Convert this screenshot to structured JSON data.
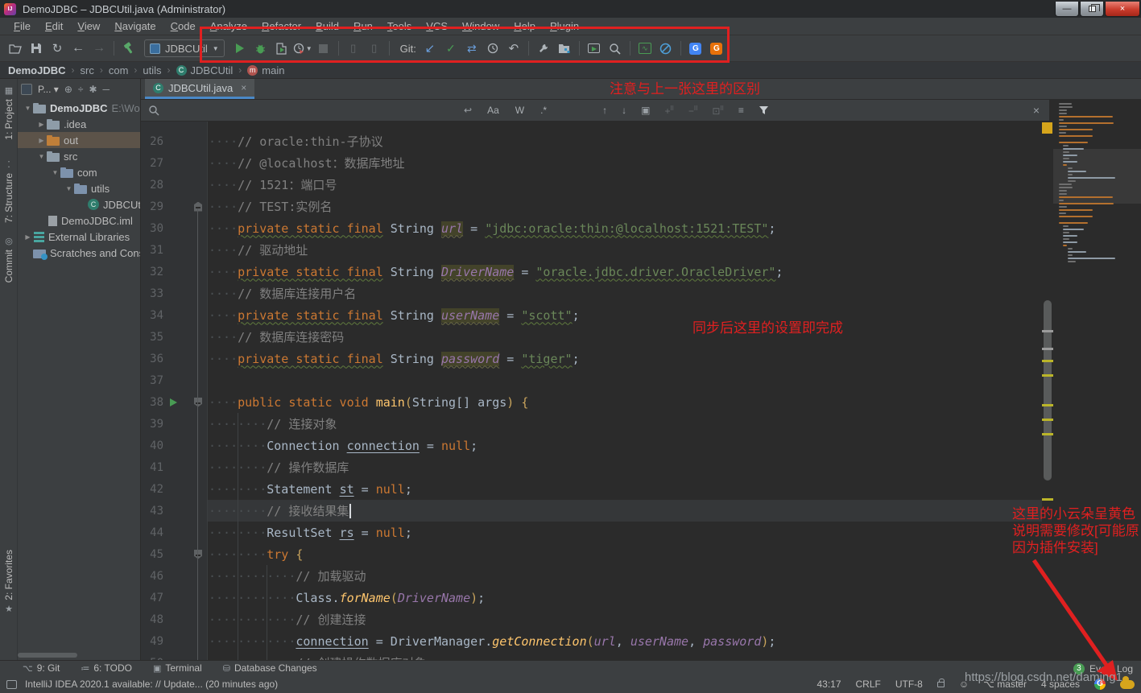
{
  "window": {
    "title": "DemoJDBC – JDBCUtil.java (Administrator)",
    "app_badge": "IJ"
  },
  "menu": [
    "File",
    "Edit",
    "View",
    "Navigate",
    "Code",
    "Analyze",
    "Refactor",
    "Build",
    "Run",
    "Tools",
    "VCS",
    "Window",
    "Help",
    "Plugin"
  ],
  "toolbar": {
    "run_config": "JDBCUtil",
    "git_label": "Git:",
    "icons": [
      "open-folder",
      "save",
      "sync",
      "back",
      "forward",
      "sep",
      "build-hammer",
      "combo",
      "run",
      "debug",
      "coverage",
      "profiler",
      "stop",
      "sep",
      "attach-phone",
      "attach-phone-down",
      "sep",
      "git-label",
      "update",
      "commit",
      "merge",
      "history",
      "rollback",
      "sep",
      "wrench",
      "project-structure",
      "sep",
      "run-console",
      "search",
      "sep",
      "monitor",
      "block",
      "sep",
      "translate-blue",
      "translate-orange"
    ]
  },
  "breadcrumbs": [
    {
      "label": "DemoJDBC",
      "icon": null
    },
    {
      "label": "src",
      "icon": null
    },
    {
      "label": "com",
      "icon": null
    },
    {
      "label": "utils",
      "icon": null
    },
    {
      "label": "JDBCUtil",
      "icon": "class"
    },
    {
      "label": "main",
      "icon": "method"
    }
  ],
  "stripe": {
    "project": "1: Project",
    "structure": "7: Structure",
    "commit": "Commit",
    "favorites": "2: Favorites"
  },
  "project_panel": {
    "header_label": "P...",
    "tree": [
      {
        "depth": 0,
        "arrow": "down",
        "icon": "folder",
        "label": "DemoJDBC",
        "bold": true,
        "suffix": "E:\\Wor",
        "selected": false
      },
      {
        "depth": 1,
        "arrow": "right",
        "icon": "folder",
        "label": ".idea",
        "selected": false
      },
      {
        "depth": 1,
        "arrow": "right",
        "icon": "folder-orange",
        "label": "out",
        "selected": true
      },
      {
        "depth": 1,
        "arrow": "down",
        "icon": "folder",
        "label": "src",
        "selected": false
      },
      {
        "depth": 2,
        "arrow": "down",
        "icon": "pkg",
        "label": "com",
        "selected": false
      },
      {
        "depth": 3,
        "arrow": "down",
        "icon": "pkg",
        "label": "utils",
        "selected": false
      },
      {
        "depth": 4,
        "arrow": null,
        "icon": "class",
        "label": "JDBCUt",
        "selected": false
      },
      {
        "depth": 1,
        "arrow": null,
        "icon": "iml",
        "label": "DemoJDBC.iml",
        "selected": false
      },
      {
        "depth": 0,
        "arrow": "right",
        "icon": "lib",
        "label": "External Libraries",
        "selected": false
      },
      {
        "depth": 0,
        "arrow": null,
        "icon": "scratch",
        "label": "Scratches and Cons",
        "selected": false
      }
    ]
  },
  "editor": {
    "tab": "JDBCUtil.java",
    "find": {
      "toggles": [
        "Aa",
        "W",
        ".*"
      ],
      "close": "×"
    },
    "code": [
      {
        "n": 26,
        "ind": 4,
        "t": [
          [
            "cmt",
            "// oracle:thin-子协议"
          ]
        ]
      },
      {
        "n": 27,
        "ind": 4,
        "t": [
          [
            "cmt",
            "// @localhost：数据库地址"
          ]
        ]
      },
      {
        "n": 28,
        "ind": 4,
        "t": [
          [
            "cmt",
            "// 1521：端口号"
          ]
        ]
      },
      {
        "n": 29,
        "ind": 4,
        "g": "foldTop",
        "t": [
          [
            "cmt",
            "// TEST:实例名"
          ]
        ]
      },
      {
        "n": 30,
        "ind": 4,
        "t": [
          [
            "kww",
            "private static final"
          ],
          [
            "pl",
            " "
          ],
          [
            "cls",
            "String"
          ],
          [
            "pl",
            " "
          ],
          [
            "fh",
            "url"
          ],
          [
            "pl",
            " = "
          ],
          [
            "strw",
            "\"jdbc:oracle:thin:@localhost:1521:TEST\""
          ],
          [
            "pl",
            ";"
          ]
        ]
      },
      {
        "n": 31,
        "ind": 4,
        "t": [
          [
            "cmt",
            "// 驱动地址"
          ]
        ]
      },
      {
        "n": 32,
        "ind": 4,
        "t": [
          [
            "kww",
            "private static final"
          ],
          [
            "pl",
            " "
          ],
          [
            "cls",
            "String"
          ],
          [
            "pl",
            " "
          ],
          [
            "fh",
            "DriverName"
          ],
          [
            "pl",
            " = "
          ],
          [
            "strw",
            "\"oracle.jdbc.driver.OracleDriver\""
          ],
          [
            "pl",
            ";"
          ]
        ]
      },
      {
        "n": 33,
        "ind": 4,
        "t": [
          [
            "cmt",
            "// 数据库连接用户名"
          ]
        ]
      },
      {
        "n": 34,
        "ind": 4,
        "t": [
          [
            "kww",
            "private static final"
          ],
          [
            "pl",
            " "
          ],
          [
            "cls",
            "String"
          ],
          [
            "pl",
            " "
          ],
          [
            "fh",
            "userName"
          ],
          [
            "pl",
            " = "
          ],
          [
            "strw",
            "\"scott\""
          ],
          [
            "pl",
            ";"
          ]
        ]
      },
      {
        "n": 35,
        "ind": 4,
        "t": [
          [
            "cmt",
            "// 数据库连接密码"
          ]
        ]
      },
      {
        "n": 36,
        "ind": 4,
        "t": [
          [
            "kww",
            "private static final"
          ],
          [
            "pl",
            " "
          ],
          [
            "cls",
            "String"
          ],
          [
            "pl",
            " "
          ],
          [
            "fh",
            "password"
          ],
          [
            "pl",
            " = "
          ],
          [
            "strw",
            "\"tiger\""
          ],
          [
            "pl",
            ";"
          ]
        ]
      },
      {
        "n": 37,
        "ind": 0,
        "t": []
      },
      {
        "n": 38,
        "ind": 4,
        "g": "runFold",
        "t": [
          [
            "kw",
            "public static void"
          ],
          [
            "pl",
            " "
          ],
          [
            "decl",
            "main"
          ],
          [
            "par",
            "("
          ],
          [
            "cls",
            "String"
          ],
          [
            "pl",
            "[] args"
          ],
          [
            "par",
            ")"
          ],
          [
            "pl",
            " "
          ],
          [
            "par",
            "{"
          ]
        ]
      },
      {
        "n": 39,
        "ind": 8,
        "t": [
          [
            "cmt",
            "// 连接对象"
          ]
        ]
      },
      {
        "n": 40,
        "ind": 8,
        "t": [
          [
            "cls",
            "Connection"
          ],
          [
            "pl",
            " "
          ],
          [
            "und",
            "connection"
          ],
          [
            "pl",
            " = "
          ],
          [
            "kw",
            "null"
          ],
          [
            "pl",
            ";"
          ]
        ]
      },
      {
        "n": 41,
        "ind": 8,
        "t": [
          [
            "cmt",
            "// 操作数据库"
          ]
        ]
      },
      {
        "n": 42,
        "ind": 8,
        "t": [
          [
            "cls",
            "Statement"
          ],
          [
            "pl",
            " "
          ],
          [
            "und",
            "st"
          ],
          [
            "pl",
            " = "
          ],
          [
            "kw",
            "null"
          ],
          [
            "pl",
            ";"
          ]
        ]
      },
      {
        "n": 43,
        "ind": 8,
        "cur": true,
        "caret": true,
        "t": [
          [
            "cmt",
            "// 接收结果集"
          ]
        ]
      },
      {
        "n": 44,
        "ind": 8,
        "t": [
          [
            "cls",
            "ResultSet"
          ],
          [
            "pl",
            " "
          ],
          [
            "und",
            "rs"
          ],
          [
            "pl",
            " = "
          ],
          [
            "kw",
            "null"
          ],
          [
            "pl",
            ";"
          ]
        ]
      },
      {
        "n": 45,
        "ind": 8,
        "g": "foldDown",
        "t": [
          [
            "kw",
            "try"
          ],
          [
            "pl",
            " "
          ],
          [
            "par",
            "{"
          ]
        ]
      },
      {
        "n": 46,
        "ind": 12,
        "t": [
          [
            "cmt",
            "// 加载驱动"
          ]
        ]
      },
      {
        "n": 47,
        "ind": 12,
        "t": [
          [
            "cls",
            "Class"
          ],
          [
            "pl",
            "."
          ],
          [
            "meth",
            "forName"
          ],
          [
            "par",
            "("
          ],
          [
            "field",
            "DriverName"
          ],
          [
            "par",
            ")"
          ],
          [
            "pl",
            ";"
          ]
        ]
      },
      {
        "n": 48,
        "ind": 12,
        "t": [
          [
            "cmt",
            "// 创建连接"
          ]
        ]
      },
      {
        "n": 49,
        "ind": 12,
        "t": [
          [
            "und",
            "connection"
          ],
          [
            "pl",
            " = "
          ],
          [
            "cls",
            "DriverManager"
          ],
          [
            "pl",
            "."
          ],
          [
            "meth",
            "getConnection"
          ],
          [
            "par",
            "("
          ],
          [
            "field",
            "url"
          ],
          [
            "pl",
            ", "
          ],
          [
            "field",
            "userName"
          ],
          [
            "pl",
            ", "
          ],
          [
            "field",
            "password"
          ],
          [
            "par",
            ")"
          ],
          [
            "pl",
            ";"
          ]
        ]
      },
      {
        "n": 50,
        "ind": 12,
        "t": [
          [
            "cmt",
            "// 创建操作数据库对象"
          ]
        ]
      }
    ]
  },
  "annotations": {
    "note_toolbar": "注意与上一张这里的区别",
    "note_sync": "同步后这里的设置即完成",
    "note_cloud_lines": [
      "这里的小云朵呈黄色",
      "说明需要修改[可能原",
      "因为插件安装]"
    ]
  },
  "watermark": "https://blog.csdn.net/daming1",
  "bottom_bar": {
    "items": [
      {
        "icon": "git-branch",
        "label": "9: Git"
      },
      {
        "icon": "todo-list",
        "label": "6: TODO"
      },
      {
        "icon": "terminal",
        "label": "Terminal"
      },
      {
        "icon": "database",
        "label": "Database Changes"
      }
    ],
    "event_log": {
      "badge": "3",
      "label": "Event Log"
    }
  },
  "status_bar": {
    "message": "IntelliJ IDEA 2020.1 available: // Update... (20 minutes ago)",
    "caret_pos": "43:17",
    "line_ending": "CRLF",
    "encoding": "UTF-8",
    "branch": "master",
    "indent": "4 spaces"
  },
  "colors": {
    "accent_tab_underline": "#4A88C7",
    "annotation_red": "#E02020",
    "warning_yellow": "#BBB529",
    "run_green": "#499C54",
    "editor_bg": "#2B2B2B",
    "panel_bg": "#3C3F41",
    "keyword": "#CC7832",
    "string": "#6A8759",
    "comment": "#808080",
    "field_purple": "#9876AA",
    "cloud_yellow": "#D6A51C"
  }
}
